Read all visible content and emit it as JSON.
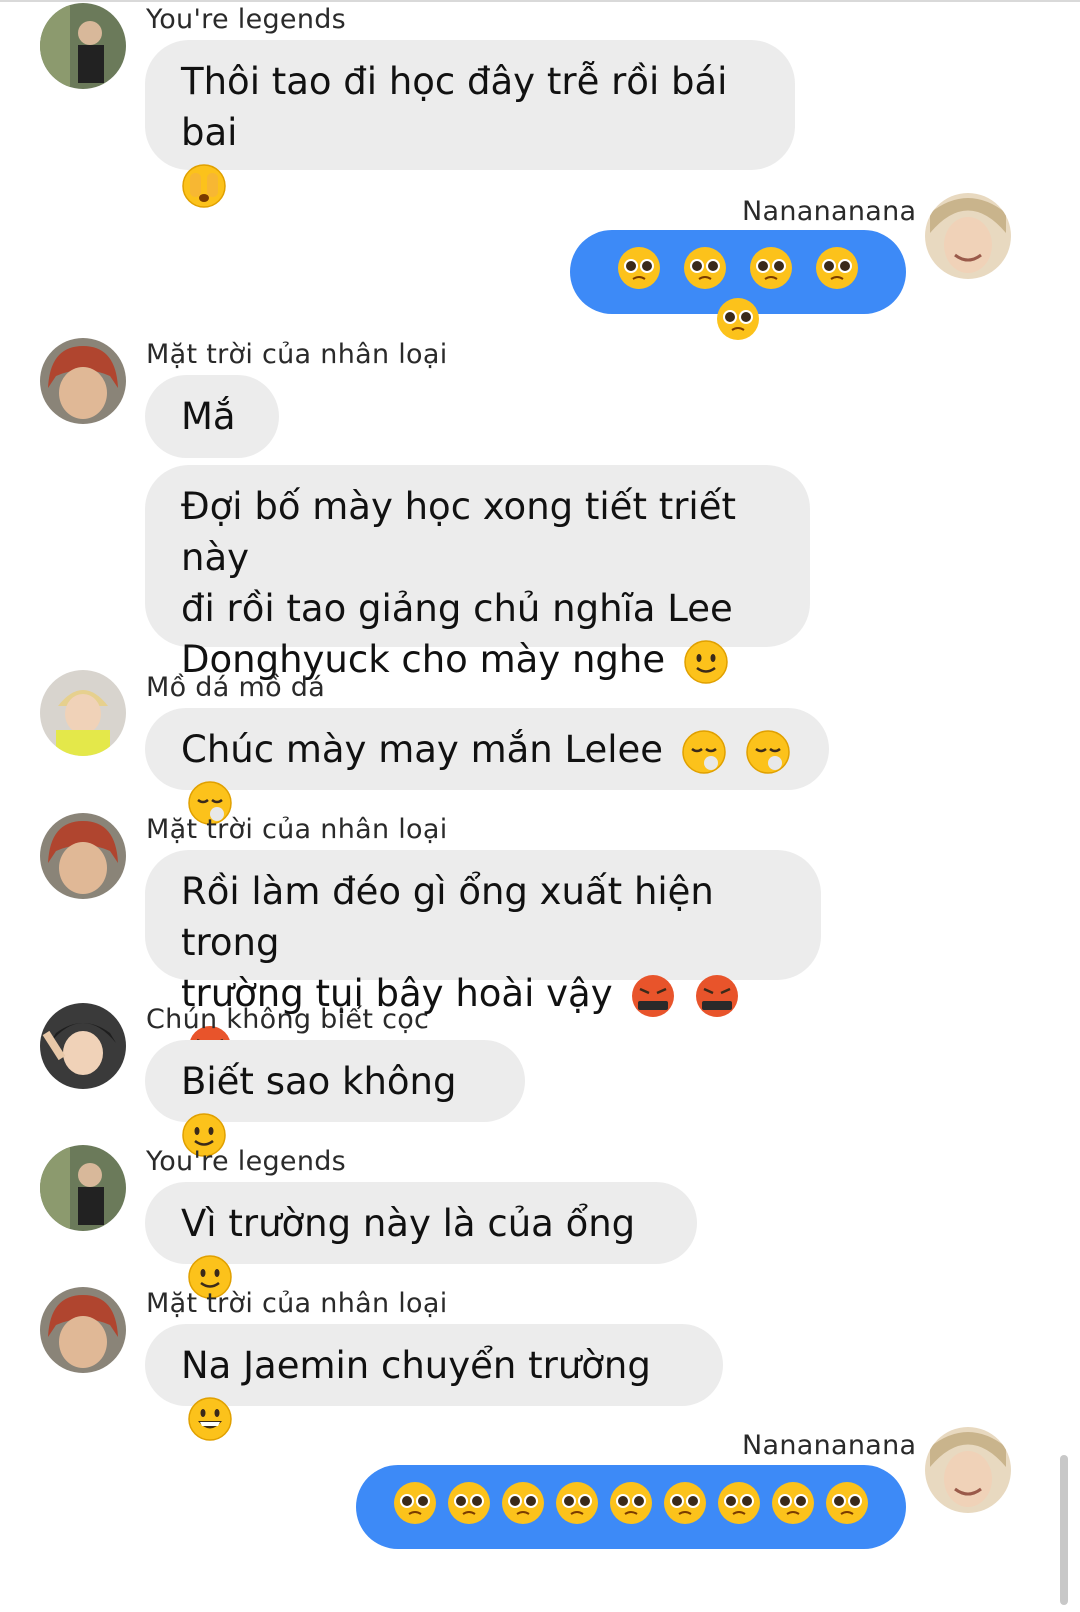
{
  "messages": [
    {
      "sender": "You're legends",
      "text": "Thôi tao đi học đây trễ rồi bái bai",
      "emoji": [
        "face-hiding-eyes"
      ],
      "direction": "in"
    },
    {
      "sender": "Nanananana",
      "text": "",
      "emoji": [
        "pleading-face",
        "pleading-face",
        "pleading-face",
        "pleading-face",
        "pleading-face"
      ],
      "direction": "out"
    },
    {
      "sender": "Mặt trời của nhân loại",
      "text": "Mắ",
      "emoji": [],
      "direction": "in"
    },
    {
      "sender": "",
      "text": "Đợi bố mày học xong tiết triết này\nđi rồi tao giảng chủ nghĩa Lee\nDonghyuck cho mày nghe",
      "emoji": [
        "slightly-smiling-face"
      ],
      "direction": "in"
    },
    {
      "sender": "Mồ dá mồ dá",
      "text": "Chúc mày may mắn Lelee",
      "emoji": [
        "face-exhaling",
        "face-exhaling",
        "face-exhaling"
      ],
      "direction": "in"
    },
    {
      "sender": "Mặt trời của nhân loại",
      "text": "Rồi làm đéo gì ổng xuất hiện trong\ntrường tụi bây hoài vậy",
      "emoji": [
        "face-with-symbols-on-mouth",
        "face-with-symbols-on-mouth",
        "face-with-symbols-on-mouth"
      ],
      "direction": "in"
    },
    {
      "sender": "Chún không biết cọc",
      "text": "Biết sao không",
      "emoji": [
        "slightly-smiling-face"
      ],
      "direction": "in"
    },
    {
      "sender": "You're legends",
      "text": "Vì trường này là của ổng",
      "emoji": [
        "slightly-smiling-face"
      ],
      "direction": "in"
    },
    {
      "sender": "Mặt trời của nhân loại",
      "text": "Na Jaemin chuyển trường",
      "emoji": [
        "grinning-face"
      ],
      "direction": "in"
    },
    {
      "sender": "Nanananana",
      "text": "",
      "emoji": [
        "pleading-face",
        "pleading-face",
        "pleading-face",
        "pleading-face",
        "pleading-face",
        "pleading-face",
        "pleading-face",
        "pleading-face",
        "pleading-face"
      ],
      "direction": "out"
    }
  ],
  "colors": {
    "outgoing_bubble": "#3d8af7",
    "incoming_bubble": "#ececec"
  }
}
